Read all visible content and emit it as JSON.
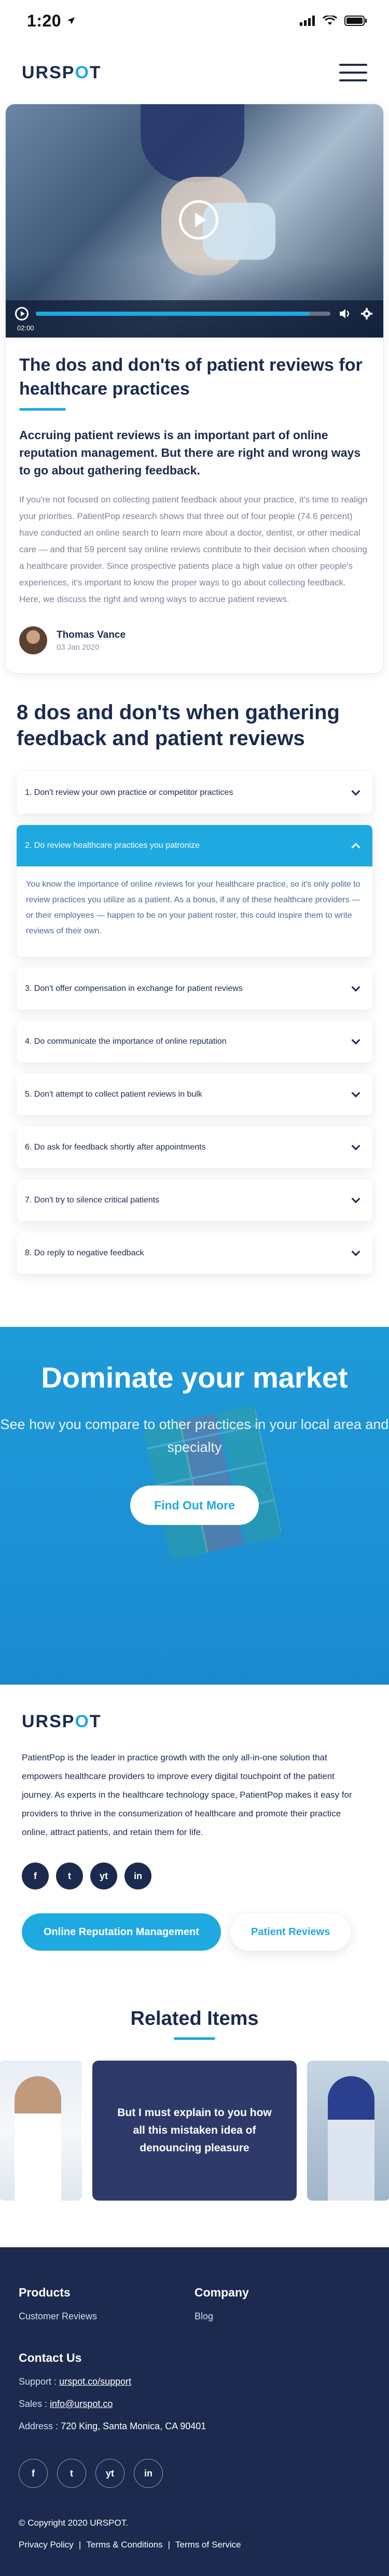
{
  "status_bar": {
    "time": "1:20",
    "icons": [
      "location-arrow-icon",
      "signal-icon",
      "wifi-icon",
      "battery-icon"
    ]
  },
  "header": {
    "logo_text": "URSPOT",
    "menu_icon": "hamburger-menu-icon"
  },
  "video": {
    "current_time": "02:00",
    "progress_fraction": 0.93
  },
  "article": {
    "title": "The dos and don'ts of patient reviews for healthcare practices",
    "lead": "Accruing patient reviews is an important part of online reputation management. But there are right and wrong ways to go about gathering feedback.",
    "body": "If you're not focused on collecting patient feedback about your practice, it's time to realign your priorities. PatientPop research shows that three out of four people (74.6 percent) have conducted an online search to learn more about a doctor, dentist, or other medical care — and that 59 percent say online reviews contribute to their decision when choosing a healthcare provider. Since prospective patients place a high value on other people's experiences, it's important to know the proper ways to go about collecting feedback. Here, we discuss the right and wrong ways to accrue patient reviews.",
    "author_name": "Thomas Vance",
    "author_date": "03 Jan 2020"
  },
  "dos": {
    "heading": "8 dos and don'ts when gathering feedback and patient reviews",
    "items": [
      {
        "label": "1. Don't review your own practice or competitor practices"
      },
      {
        "label": "2. Do review healthcare practices you patronize",
        "body": "You know the importance of online reviews for your healthcare practice, so it's only polite to review practices you utilize as a patient. As a bonus, if any of these healthcare providers — or their employees — happen to be on your patient roster, this could inspire them to write reviews of their own."
      },
      {
        "label": "3. Don't offer compensation in exchange for patient reviews"
      },
      {
        "label": "4. Do communicate the importance of online reputation"
      },
      {
        "label": "5. Don't attempt to collect patient reviews in bulk"
      },
      {
        "label": "6. Do ask for feedback shortly after appointments"
      },
      {
        "label": "7. Don't try to silence critical patients"
      },
      {
        "label": "8. Do reply to negative feedback"
      }
    ]
  },
  "cta": {
    "title": "Dominate your market",
    "subtitle": "See how you compare to other practices in your local area and specialty",
    "button": "Find Out More"
  },
  "about": {
    "logo_text": "URSPOT",
    "text": "PatientPop is the leader in practice growth with the only all-in-one solution that empowers healthcare providers to improve every digital touchpoint of the patient journey. As experts in the healthcare technology space, PatientPop makes it easy for providers to thrive in the consumerization of healthcare and promote their practice online, attract patients, and retain them for life.",
    "social": [
      "f",
      "t",
      "yt",
      "in"
    ],
    "tag_primary": "Online Reputation Management",
    "tag_secondary": "Patient Reviews"
  },
  "related": {
    "title": "Related Items",
    "center_text": "But I must explain to you how all this mistaken idea of denouncing pleasure"
  },
  "footer": {
    "products_h": "Products",
    "products_link": "Customer Reviews",
    "company_h": "Company",
    "company_link": "Blog",
    "contact_h": "Contact Us",
    "support_label": "Support :",
    "support_val": "urspot.co/support",
    "sales_label": "Sales :",
    "sales_val": "info@urspot.co",
    "address_label": "Address :",
    "address_val": "720 King, Santa Monica, CA 90401",
    "social": [
      "f",
      "t",
      "yt",
      "in"
    ],
    "copyright": "© Copyright 2020 URSPOT.",
    "privacy": "Privacy Policy",
    "terms": "Terms & Conditions",
    "service": "Terms of Service",
    "sep": "|"
  },
  "colors": {
    "accent": "#1fa9e1",
    "navy": "#1b2a4e",
    "muted": "#7b8599"
  }
}
